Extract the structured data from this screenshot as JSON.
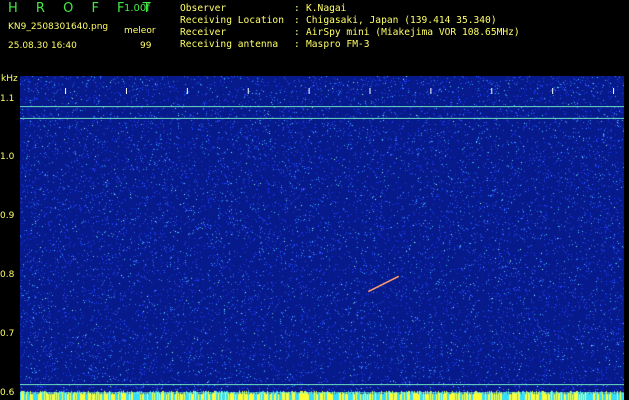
{
  "header": {
    "brand": "H R O F F T",
    "version": "1.00f",
    "filename": "KN9_2508301640.png",
    "program": "meleor",
    "datetime": "25.08.30 16:40",
    "count": "99"
  },
  "info": [
    {
      "label": "Observer",
      "value": "K.Nagai"
    },
    {
      "label": "Receiving Location",
      "value": "Chigasaki, Japan (139.414 35.340)"
    },
    {
      "label": "Receiver",
      "value": "AirSpy mini (Miakejima VOR 108.65MHz)"
    },
    {
      "label": "Receiving antenna",
      "value": "Maspro FM-3"
    }
  ],
  "chart_data": {
    "type": "heatmap",
    "y_unit": "kHz",
    "yticks": [
      "1.1",
      "1.0",
      "0.9",
      "0.8",
      "0.7",
      "0.6"
    ],
    "xticks": [
      "1641",
      "1642",
      "1643",
      "1644",
      "1645",
      "1646",
      "1647",
      "1648",
      "1649",
      "1650"
    ],
    "ylim": [
      0.59,
      1.14
    ],
    "xlim": [
      1640.58,
      1650.5
    ],
    "continuous_lines_khz": [
      1.088,
      1.068,
      0.616,
      0.602
    ],
    "meteor_trace": {
      "x": [
        1646.3,
        1646.8
      ],
      "y": [
        0.774,
        0.8
      ]
    },
    "colors": {
      "background": "#061a8c",
      "noise": [
        "#1e3cff",
        "#2f66ff",
        "#3aa0ff",
        "#48d8ff",
        "#9cffd8"
      ],
      "line": "#7dffc8",
      "axis_text": "#ffff66",
      "brand": "#45e845"
    }
  }
}
